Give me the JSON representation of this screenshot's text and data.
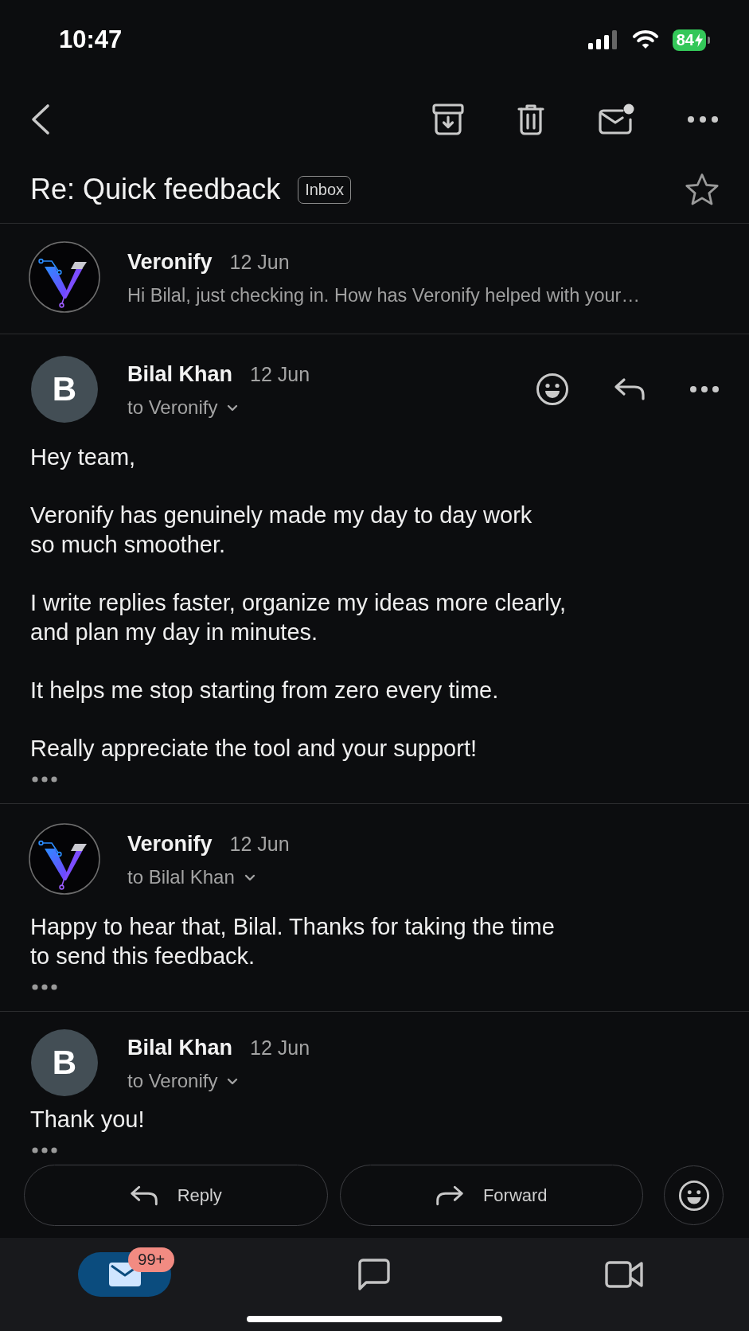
{
  "status_bar": {
    "time": "10:47",
    "battery": "84",
    "charging": true
  },
  "subject": {
    "title": "Re: Quick feedback",
    "label": "Inbox",
    "starred": false
  },
  "messages": [
    {
      "kind": "collapsed",
      "avatar": {
        "kind": "logo"
      },
      "sender": "Veronify",
      "date": "12 Jun",
      "preview": "Hi Bilal, just checking in. How has Veronify helped with your…"
    },
    {
      "kind": "expanded",
      "avatar": {
        "kind": "initial",
        "text": "B"
      },
      "sender": "Bilal Khan",
      "date": "12 Jun",
      "recipient": "to Veronify",
      "actions": [
        {
          "kind": "react"
        },
        {
          "kind": "reply"
        },
        {
          "kind": "more"
        }
      ],
      "body": [
        [
          "Hey team,"
        ],
        [
          "Veronify has genuinely made my day to day work",
          "so much smoother."
        ],
        [
          "I write replies faster, organize my ideas more clearly,",
          "and plan my day in minutes."
        ],
        [
          "It helps me stop starting from zero every time."
        ],
        [
          "Really appreciate the tool and your support!"
        ]
      ]
    },
    {
      "kind": "expanded",
      "avatar": {
        "kind": "logo"
      },
      "sender": "Veronify",
      "date": "12 Jun",
      "recipient": "to Bilal Khan",
      "body": [
        [
          "Happy to hear that, Bilal. Thanks for taking the time",
          "to send this feedback."
        ]
      ]
    },
    {
      "kind": "expanded",
      "avatar": {
        "kind": "initial",
        "text": "B"
      },
      "sender": "Bilal Khan",
      "date": "12 Jun",
      "recipient": "to Veronify",
      "body": [
        [
          "Thank you!"
        ]
      ]
    }
  ],
  "action_bar": {
    "buttons": [
      {
        "kind": "reply",
        "label": "Reply"
      },
      {
        "kind": "forward",
        "label": "Forward"
      },
      {
        "kind": "react"
      }
    ]
  },
  "nav": {
    "tabs": [
      {
        "kind": "mail",
        "selected": true,
        "badge": "99+"
      },
      {
        "kind": "chat",
        "selected": false
      },
      {
        "kind": "video",
        "selected": false
      }
    ]
  }
}
